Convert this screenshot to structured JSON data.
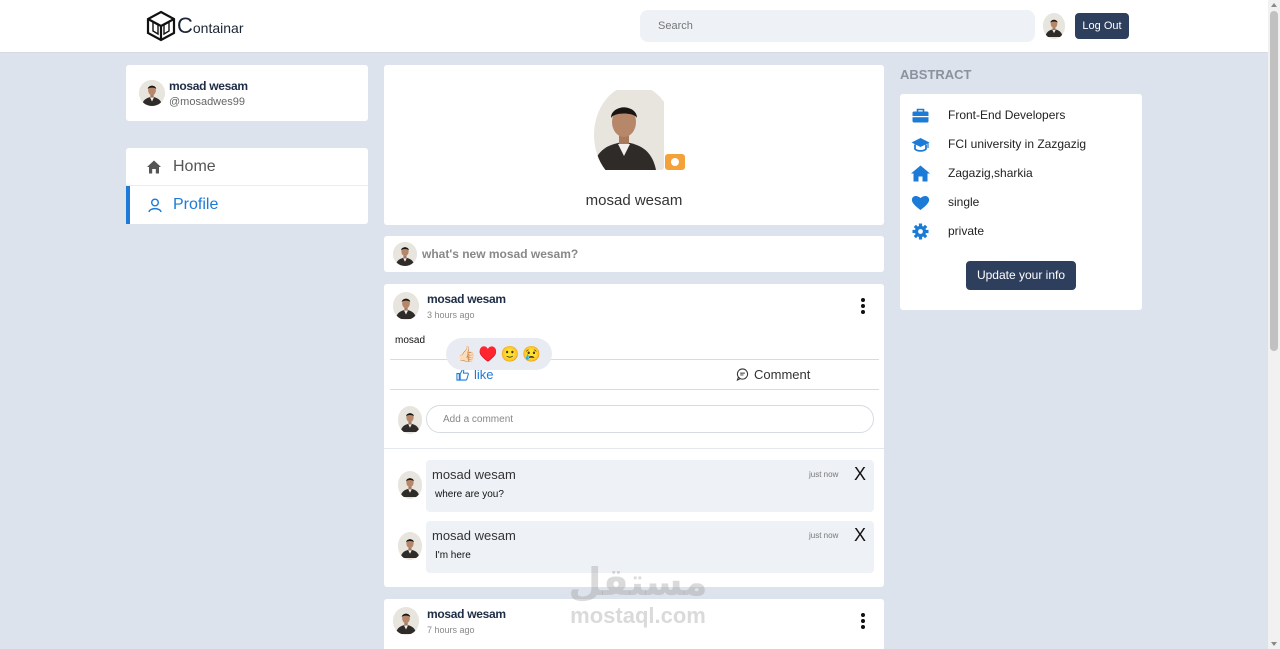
{
  "header": {
    "logo_text_initial": "C",
    "logo_text_rest": "ontainar",
    "search_placeholder": "Search",
    "logout_label": "Log Out"
  },
  "user": {
    "name": "mosad wesam",
    "handle": "@mosadwes99"
  },
  "nav": {
    "items": [
      {
        "label": "Home",
        "icon": "home-icon",
        "active": false
      },
      {
        "label": "Profile",
        "icon": "user-icon",
        "active": true
      }
    ]
  },
  "profile": {
    "name": "mosad wesam"
  },
  "composer": {
    "placeholder": "what's new mosad wesam?"
  },
  "posts": [
    {
      "author": "mosad wesam",
      "time": "3 hours ago",
      "text": "mosad",
      "reactions": [
        "👍🏻",
        "♥️",
        "🙂",
        "😢"
      ],
      "like_label": "like",
      "comment_label": "Comment",
      "comment_placeholder": "Add a comment",
      "comments": [
        {
          "author": "mosad wesam",
          "time": "just now",
          "text": "where are you?",
          "close": "X"
        },
        {
          "author": "mosad wesam",
          "time": "just now",
          "text": "I'm here",
          "close": "X"
        }
      ]
    },
    {
      "author": "mosad wesam",
      "time": "7 hours ago"
    }
  ],
  "abstract": {
    "title": "ABSTRACT",
    "items": [
      {
        "icon": "briefcase-icon",
        "text": "Front-End Developers"
      },
      {
        "icon": "graduation-cap-icon",
        "text": "FCI university in Zazgazig"
      },
      {
        "icon": "house-icon",
        "text": "Zagazig,sharkia"
      },
      {
        "icon": "heart-icon",
        "text": "single"
      },
      {
        "icon": "gear-icon",
        "text": "private"
      }
    ],
    "update_label": "Update your info"
  },
  "watermark": {
    "arabic": "مستقل",
    "latin": "mostaql.com"
  },
  "colors": {
    "accent": "#1c7bd6",
    "button": "#2e3f5e",
    "background": "#dde3ec",
    "icon": "#1c7bd6"
  }
}
